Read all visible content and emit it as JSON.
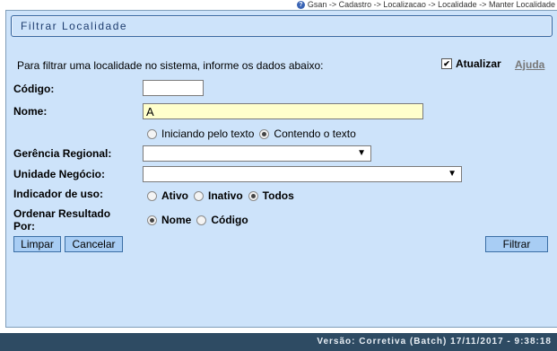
{
  "breadcrumb": {
    "icon": "help-icon",
    "path": "Gsan -> Cadastro -> Localizacao -> Localidade -> Manter Localidade"
  },
  "form": {
    "title": "Filtrar Localidade",
    "intro": "Para filtrar uma localidade no sistema, informe os dados abaixo:",
    "atualizar": {
      "label": "Atualizar",
      "checked": true
    },
    "ajuda_label": "Ajuda",
    "codigo": {
      "label": "Código:",
      "value": ""
    },
    "nome": {
      "label": "Nome:",
      "value": "A"
    },
    "nome_match": {
      "options": [
        "Iniciando pelo texto",
        "Contendo o texto"
      ],
      "selected": "Contendo o texto"
    },
    "gerencia_regional": {
      "label": "Gerência Regional:",
      "value": ""
    },
    "unidade_negocio": {
      "label": "Unidade Negócio:",
      "value": ""
    },
    "indicador_uso": {
      "label": "Indicador de uso:",
      "options": [
        "Ativo",
        "Inativo",
        "Todos"
      ],
      "selected": "Todos"
    },
    "ordenar": {
      "label_line1": "Ordenar Resultado",
      "label_line2": "Por:",
      "options": [
        "Nome",
        "Código"
      ],
      "selected": "Nome"
    },
    "buttons": {
      "limpar": "Limpar",
      "cancelar": "Cancelar",
      "filtrar": "Filtrar"
    }
  },
  "footer": {
    "version": "Versão: Corretiva (Batch) 17/11/2017 - 9:38:18"
  },
  "colors": {
    "panel_bg": "#cde3fa",
    "footer_bg": "#2e4b63",
    "button_bg": "#a8cdf4",
    "nome_input_bg": "#ffffcc"
  }
}
